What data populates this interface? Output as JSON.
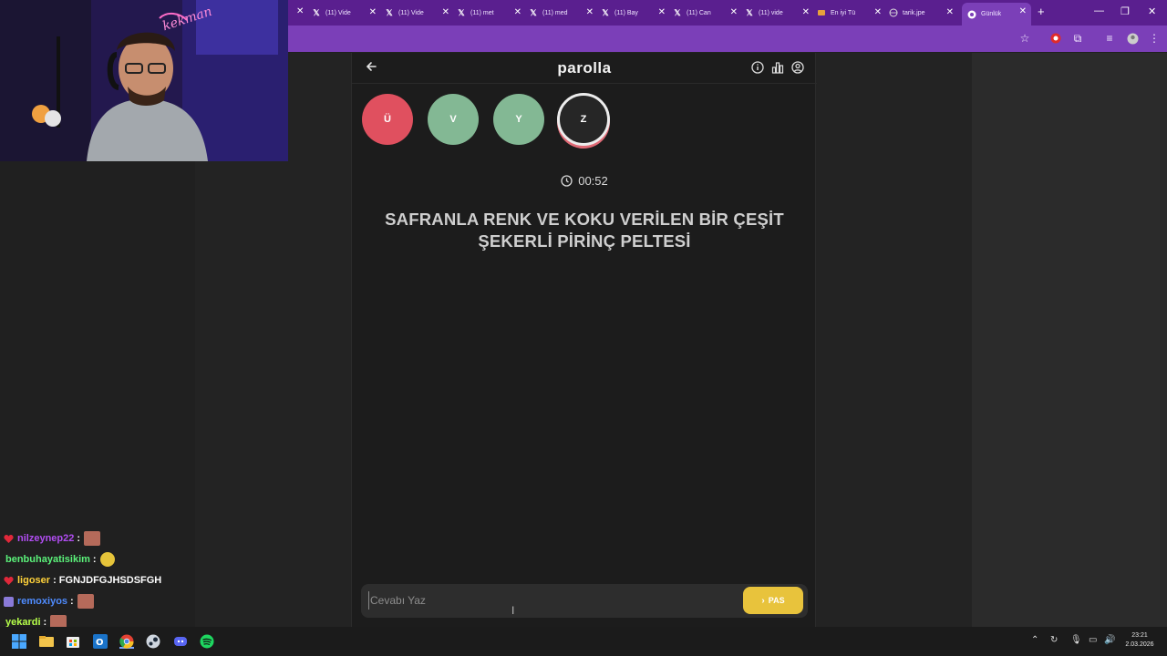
{
  "browser": {
    "tabs": [
      {
        "label": "(11) Vide",
        "icon": "x-logo-icon"
      },
      {
        "label": "(11) Vide",
        "icon": "x-logo-icon"
      },
      {
        "label": "(11) met",
        "icon": "x-logo-icon"
      },
      {
        "label": "(11) med",
        "icon": "x-logo-icon"
      },
      {
        "label": "(11) Bay",
        "icon": "x-logo-icon"
      },
      {
        "label": "(11) Can",
        "icon": "x-logo-icon"
      },
      {
        "label": "(11) vide",
        "icon": "x-logo-icon"
      },
      {
        "label": "En iyi Tü",
        "icon": "page-icon"
      },
      {
        "label": "tarik.jpe",
        "icon": "globe-icon"
      },
      {
        "label": "Günlük",
        "icon": "chrome-icon",
        "active": true
      }
    ]
  },
  "app": {
    "title": "parolla",
    "letters": [
      {
        "letter": "Ü",
        "state": "wrong",
        "color": "#e0505f"
      },
      {
        "letter": "V",
        "state": "correct",
        "color": "#83b894"
      },
      {
        "letter": "Y",
        "state": "correct",
        "color": "#83b894"
      },
      {
        "letter": "Z",
        "state": "current",
        "color": "#262626"
      }
    ],
    "timer": "00:52",
    "clue": "SAFRANLA RENK VE KOKU VERİLEN BİR ÇEŞİT ŞEKERLİ PİRİNÇ PELTESİ",
    "answer_placeholder": "Cevabı Yaz",
    "pass_label": "PAS",
    "accent": "#e8c33c"
  },
  "chat": {
    "messages": [
      {
        "user": "nilzeynep22",
        "color": "#b14df2",
        "text": ":",
        "emote": true
      },
      {
        "user": "benbuhayatisikim",
        "color": "#5bf27a",
        "text": ":",
        "emote": true
      },
      {
        "user": "ligoser",
        "color": "#ffd23a",
        "text": ": FGNJDFGJHSDSFGH",
        "emote": false
      },
      {
        "user": "remoxiyos",
        "color": "#4f8cff",
        "text": ":",
        "emote": true
      },
      {
        "user": "yekardi",
        "color": "#b6ff4a",
        "text": ":",
        "emote": true
      }
    ]
  },
  "taskbar": {
    "time": "23:21",
    "date": "2.03.2026"
  }
}
